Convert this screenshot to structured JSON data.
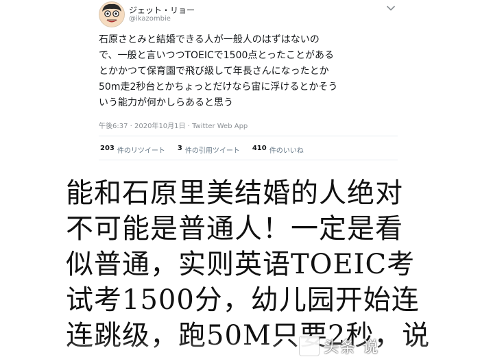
{
  "tweet": {
    "display_name": "ジェット・リョー",
    "handle": "@ikazombie",
    "text": "石原さとみと結婚できる人が一般人のはずはないの\nで、一般と言いつつTOEICで1500点とったことがある\nとかかつて保育園で飛び級して年長さんになったとか\n50m走2秒台とかちょっとだけなら宙に浮けるとかそう\nいう能力が何かしらあると思う",
    "timestamp": "午後6:37 · 2020年10月1日 · Twitter Web App",
    "stats": [
      {
        "count": "203",
        "label": "件のリツイート"
      },
      {
        "count": "3",
        "label": "件の引用ツイート"
      },
      {
        "count": "410",
        "label": "件のいいね"
      }
    ],
    "icons": {
      "avatar": "avatar",
      "more": "chevron-down-icon"
    }
  },
  "caption": {
    "text": "能和石原里美结婚的人绝对\n不可能是普通人！一定是看\n似普通，实则英语TOEIC考\n试考1500分，幼儿园开始连\n连跳级，跑50M只要2秒，说"
  },
  "watermark": {
    "text": "头条 说"
  },
  "colors": {
    "text_primary": "#14171a",
    "text_secondary": "#8a8f94",
    "divider": "#e6ecf0",
    "background": "#ffffff"
  }
}
